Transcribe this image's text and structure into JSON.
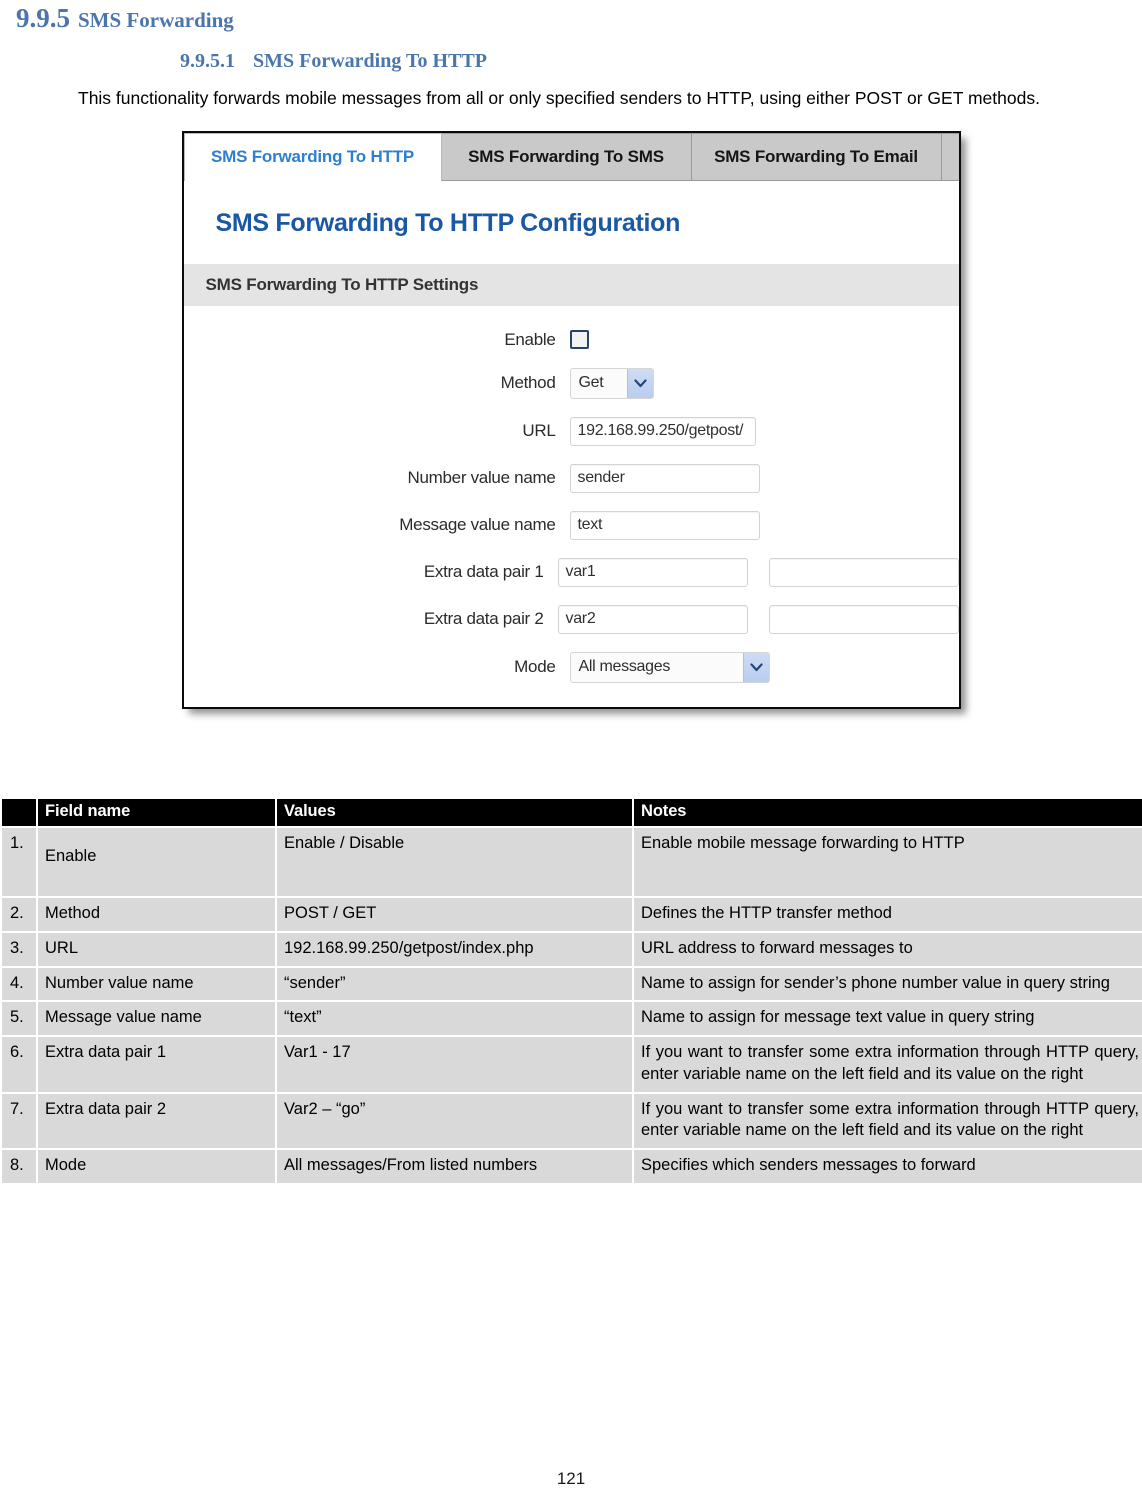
{
  "document": {
    "heading": {
      "number": "9.9.5",
      "title": "SMS Forwarding"
    },
    "subheading": {
      "number": "9.9.5.1",
      "title": "SMS Forwarding To HTTP"
    },
    "intro": "This functionality forwards mobile messages from all or only specified senders to HTTP, using either POST or GET methods.",
    "page_number": "121"
  },
  "screenshot": {
    "tabs": [
      {
        "label": "SMS Forwarding To HTTP",
        "active": true
      },
      {
        "label": "SMS Forwarding To SMS",
        "active": false
      },
      {
        "label": "SMS Forwarding To Email",
        "active": false
      }
    ],
    "config_title": "SMS Forwarding To HTTP Configuration",
    "settings_bar": "SMS Forwarding To HTTP Settings",
    "fields": {
      "enable": {
        "label": "Enable",
        "checked": false
      },
      "method": {
        "label": "Method",
        "value": "Get"
      },
      "url": {
        "label": "URL",
        "value": "192.168.99.250/getpost/"
      },
      "number_value_name": {
        "label": "Number value name",
        "value": "sender"
      },
      "message_value_name": {
        "label": "Message value name",
        "value": "text"
      },
      "extra_data_pair_1": {
        "label": "Extra data pair 1",
        "key": "var1",
        "value": ""
      },
      "extra_data_pair_2": {
        "label": "Extra data pair 2",
        "key": "var2",
        "value": ""
      },
      "mode": {
        "label": "Mode",
        "value": "All messages"
      }
    },
    "colors": {
      "active_tab_text": "#2f7fd0",
      "config_title": "#1a57a5",
      "inactive_tab_bg": "#c9c9c9",
      "settings_bar_bg": "#e4e4e4",
      "checkbox_border": "#24436b",
      "select_arrow": "#b9cdee"
    }
  },
  "table": {
    "headers": [
      "",
      "Field name",
      "Values",
      "Notes"
    ],
    "rows": [
      {
        "index": "1.",
        "name": "Enable",
        "values": "Enable / Disable",
        "notes": "Enable mobile message forwarding to HTTP"
      },
      {
        "index": "2.",
        "name": "Method",
        "values": "POST / GET",
        "notes": "Defines the HTTP transfer method"
      },
      {
        "index": "3.",
        "name": "URL",
        "values": "192.168.99.250/getpost/index.php",
        "notes": "URL address to forward messages to"
      },
      {
        "index": "4.",
        "name": "Number value name",
        "values": "“sender”",
        "notes": "Name to assign for sender’s phone number value in query string"
      },
      {
        "index": "5.",
        "name": "Message value name",
        "values": "“text”",
        "notes": "Name to assign for message text value in query string"
      },
      {
        "index": "6.",
        "name": "Extra data pair 1",
        "values": "Var1 - 17",
        "notes": "If you want to transfer some extra information through HTTP query, enter variable name on the left field and its value on the right"
      },
      {
        "index": "7.",
        "name": "Extra data pair 2",
        "values": "Var2 – “go”",
        "notes": "If you want to transfer some extra information through HTTP query, enter variable name on the left field and its value on the right"
      },
      {
        "index": "8.",
        "name": "Mode",
        "values": "All messages/From listed numbers",
        "notes": "Specifies which senders messages to forward"
      }
    ]
  }
}
